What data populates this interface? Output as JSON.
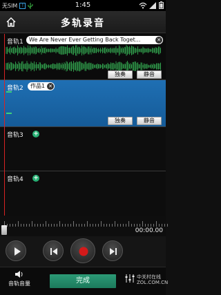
{
  "status_bar": {
    "carrier": "无SIM",
    "time": "1:45"
  },
  "header": {
    "title": "多轨录音"
  },
  "tracks": [
    {
      "label": "音轨1",
      "name": "We Are Never Ever Getting Back Toget...",
      "solo": "独奏",
      "mute": "静音"
    },
    {
      "label": "音轨2",
      "name": "作品1",
      "solo": "独奏",
      "mute": "静音"
    },
    {
      "label": "音轨3"
    },
    {
      "label": "音轨4"
    }
  ],
  "timeline": {
    "time": "00:00.00"
  },
  "footer": {
    "volume_label": "音轨音量",
    "done_label": "完成",
    "watermark_1": "中关村在线",
    "watermark_2": "ZOL.COM.CN"
  },
  "colors": {
    "selected_track": "#1f6fb3",
    "waveform": "#2f9a4a",
    "record": "#d41a1a",
    "done_button": "#2c9a76"
  },
  "icons": [
    "home-icon",
    "play-icon",
    "previous-icon",
    "record-icon",
    "next-icon",
    "mixer-icon",
    "close-icon",
    "add-icon",
    "wifi-icon",
    "battery-icon",
    "usb-icon"
  ]
}
